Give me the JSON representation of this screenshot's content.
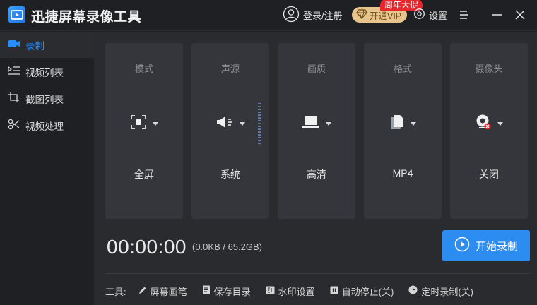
{
  "app": {
    "title": "迅捷屏幕录像工具"
  },
  "header": {
    "login_label": "登录/注册",
    "vip_label": "开通VIP",
    "promo_badge": "周年大促",
    "settings_label": "设置"
  },
  "sidebar": {
    "items": [
      {
        "label": "录制",
        "icon": "video-camera-icon",
        "active": true
      },
      {
        "label": "视频列表",
        "icon": "video-list-icon"
      },
      {
        "label": "截图列表",
        "icon": "screenshot-list-icon"
      },
      {
        "label": "视频处理",
        "icon": "video-process-icon"
      }
    ]
  },
  "cards": [
    {
      "title": "模式",
      "value": "全屏",
      "icon": "fullscreen-icon"
    },
    {
      "title": "声源",
      "value": "系统",
      "icon": "speaker-icon"
    },
    {
      "title": "画质",
      "value": "高清",
      "icon": "laptop-icon"
    },
    {
      "title": "格式",
      "value": "MP4",
      "icon": "file-format-icon"
    },
    {
      "title": "摄像头",
      "value": "关闭",
      "icon": "camera-off-icon"
    }
  ],
  "recording": {
    "timer": "00:00:00",
    "size": "(0.0KB / 65.2GB)",
    "start_label": "开始录制"
  },
  "toolbar": {
    "label": "工具:",
    "items": [
      {
        "label": "屏幕画笔",
        "icon": "pen-icon"
      },
      {
        "label": "保存目录",
        "icon": "document-icon"
      },
      {
        "label": "水印设置",
        "icon": "watermark-icon"
      },
      {
        "label": "自动停止(关)",
        "icon": "pause-icon"
      },
      {
        "label": "定时录制(关)",
        "icon": "clock-icon"
      }
    ]
  },
  "colors": {
    "accent": "#2d8cf0",
    "vip": "#e7c48c",
    "promo": "#e8262c",
    "background": "#2a2b2f"
  }
}
